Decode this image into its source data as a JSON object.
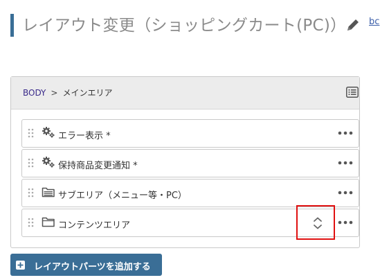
{
  "header": {
    "title": "レイアウト変更（ショッピングカート(PC)）",
    "edit_icon": "pencil-icon",
    "cut_link_text": "bc"
  },
  "panel": {
    "breadcrumb": {
      "root": "BODY",
      "separator": ">",
      "current": "メインエリア"
    },
    "list_icon": "list-view-icon",
    "rows": [
      {
        "icon": "gears-icon",
        "label": "エラー表示",
        "required_mark": "*"
      },
      {
        "icon": "gears-icon",
        "label": "保持商品変更通知",
        "required_mark": "*"
      },
      {
        "icon": "folder-filled-icon",
        "label": "サブエリア（メニュー等・PC）",
        "required_mark": ""
      },
      {
        "icon": "folder-open-icon",
        "label": "コンテンツエリア",
        "required_mark": ""
      }
    ]
  },
  "add_button": {
    "label": "レイアウトパーツを追加する",
    "icon": "plus-square-icon"
  },
  "colors": {
    "accent": "#3a6e96",
    "highlight": "#e01010",
    "panel_header_bg": "#ececec",
    "title_text": "#8a8a8a"
  }
}
